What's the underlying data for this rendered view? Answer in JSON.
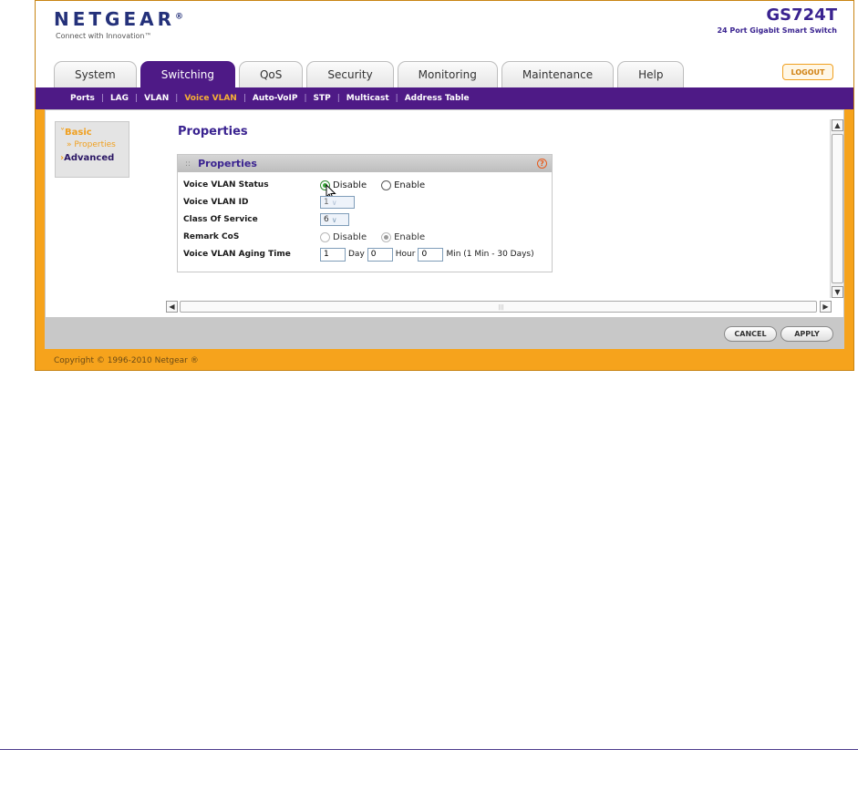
{
  "header": {
    "logo": "NETGEAR",
    "logo_mark": "®",
    "tagline": "Connect with Innovation™",
    "model": "GS724T",
    "model_subtitle": "24 Port Gigabit Smart Switch",
    "logout_label": "LOGOUT"
  },
  "tabs": [
    {
      "label": "System",
      "active": false
    },
    {
      "label": "Switching",
      "active": true
    },
    {
      "label": "QoS",
      "active": false
    },
    {
      "label": "Security",
      "active": false
    },
    {
      "label": "Monitoring",
      "active": false
    },
    {
      "label": "Maintenance",
      "active": false
    },
    {
      "label": "Help",
      "active": false
    }
  ],
  "subnav": [
    {
      "label": "Ports",
      "active": false
    },
    {
      "label": "LAG",
      "active": false
    },
    {
      "label": "VLAN",
      "active": false
    },
    {
      "label": "Voice VLAN",
      "active": true
    },
    {
      "label": "Auto-VoIP",
      "active": false
    },
    {
      "label": "STP",
      "active": false
    },
    {
      "label": "Multicast",
      "active": false
    },
    {
      "label": "Address Table",
      "active": false
    }
  ],
  "subnav_separator": "|",
  "leftnav": {
    "basic_label": "Basic",
    "basic_caret": "˅",
    "properties_label": "» Properties",
    "advanced_label": "Advanced",
    "advanced_caret": "›"
  },
  "page": {
    "title": "Properties",
    "panel_title": "Properties",
    "panel_grip": "::",
    "help_glyph": "?"
  },
  "form": {
    "voice_vlan_status": {
      "label": "Voice VLAN Status",
      "option_disable": "Disable",
      "option_enable": "Enable",
      "selected": "Disable"
    },
    "voice_vlan_id": {
      "label": "Voice VLAN ID",
      "value": "1"
    },
    "class_of_service": {
      "label": "Class Of Service",
      "value": "6"
    },
    "remark_cos": {
      "label": "Remark CoS",
      "option_disable": "Disable",
      "option_enable": "Enable",
      "selected": "Enable"
    },
    "aging_time": {
      "label": "Voice VLAN Aging Time",
      "day_value": "1",
      "day_unit": "Day",
      "hour_value": "0",
      "hour_unit": "Hour",
      "min_value": "0",
      "min_unit": "Min (1 Min - 30 Days)"
    }
  },
  "scroll": {
    "up": "▲",
    "down": "▼",
    "left": "◀",
    "right": "▶",
    "grip": "|||"
  },
  "footer": {
    "cancel_label": "CANCEL",
    "apply_label": "APPLY",
    "copyright": "Copyright © 1996-2010 Netgear ®"
  },
  "colors": {
    "frame_orange": "#f6a31c",
    "nav_purple": "#4e1a86",
    "title_purple": "#3a2390",
    "active_subnav": "#f6b035"
  },
  "icons": {
    "cursor": "mouse-pointer-icon",
    "help": "help-circle-icon"
  }
}
